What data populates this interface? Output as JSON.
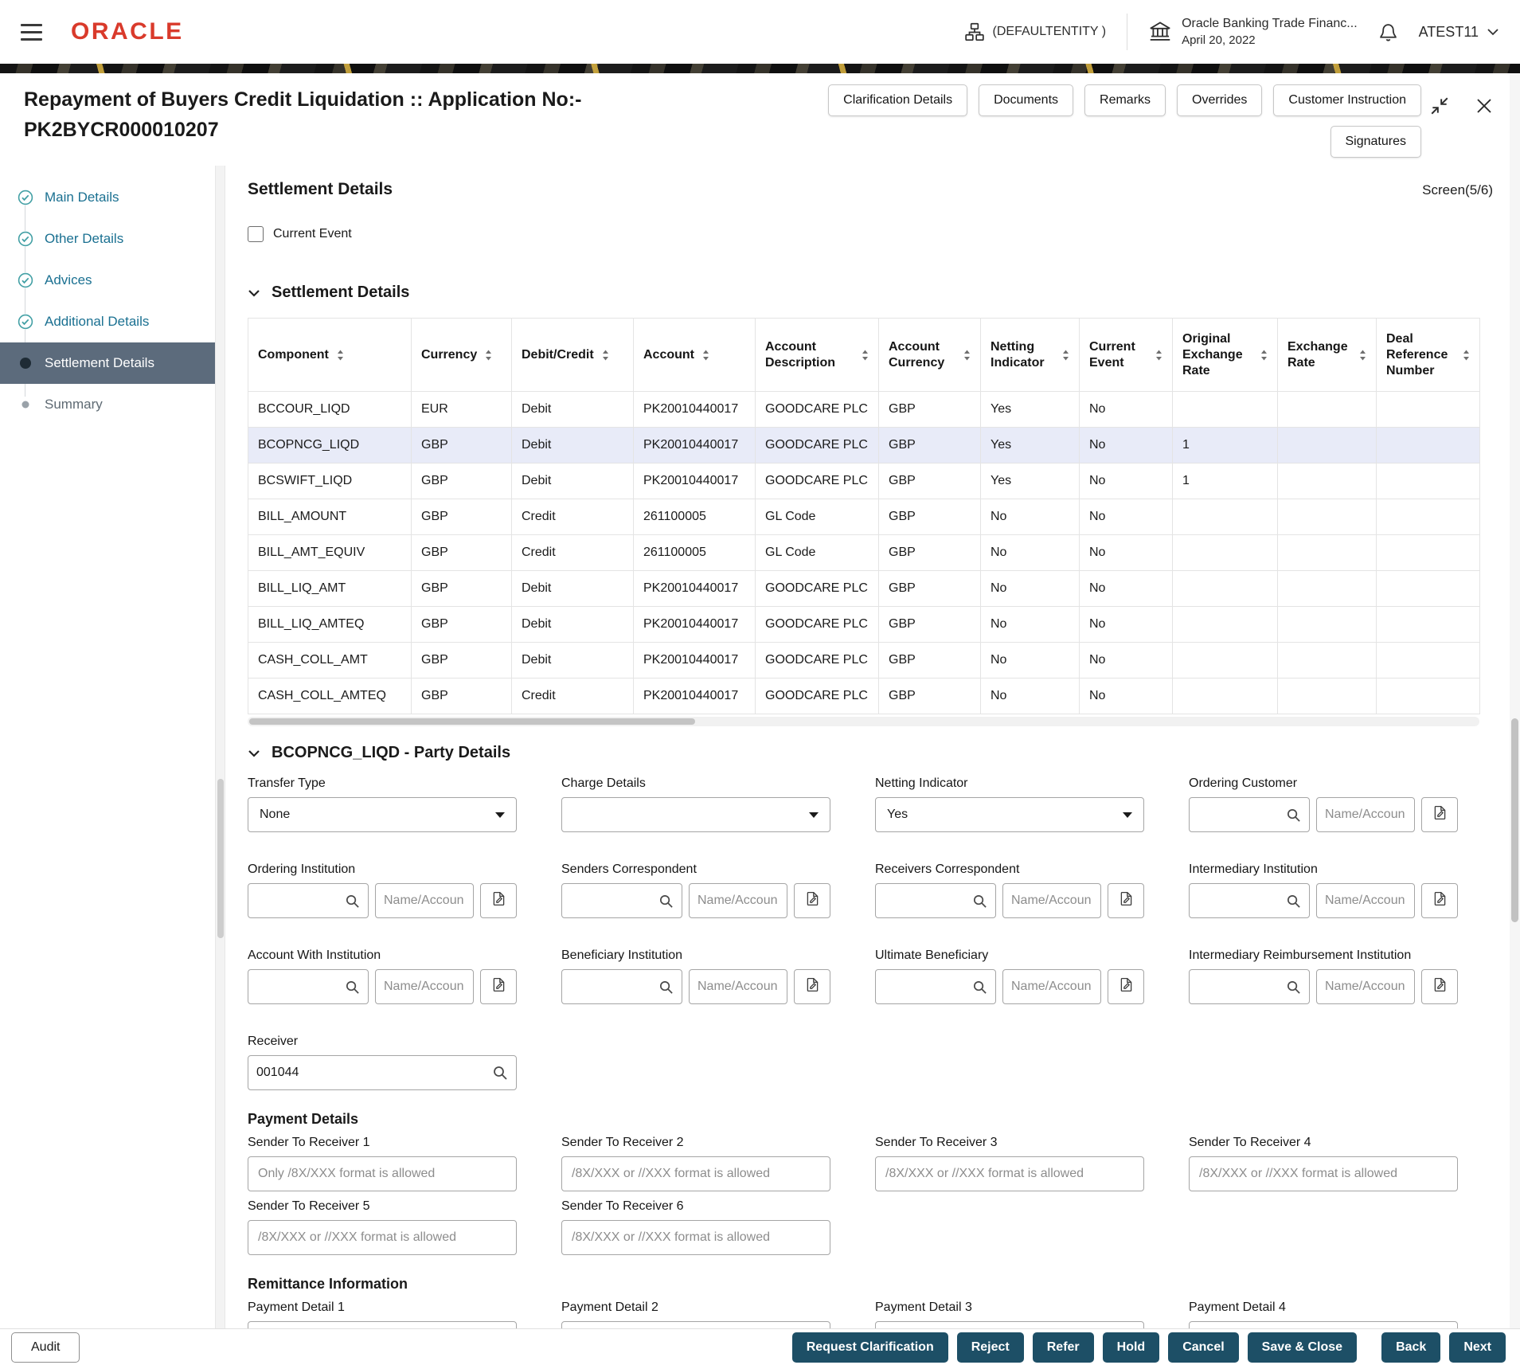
{
  "header": {
    "logo": "ORACLE",
    "entity_label": "(DEFAULTENTITY )",
    "app_name": "Oracle Banking Trade Financ...",
    "app_date": "April 20, 2022",
    "user_name": "ATEST11"
  },
  "titlebar": {
    "title_line1": "Repayment of Buyers Credit Liquidation :: Application No:-",
    "title_line2": "PK2BYCR000010207",
    "action_buttons": [
      "Clarification Details",
      "Documents",
      "Remarks",
      "Overrides",
      "Customer Instruction"
    ],
    "signatures_label": "Signatures"
  },
  "sidebar": {
    "items": [
      {
        "label": "Main Details",
        "state": "done"
      },
      {
        "label": "Other Details",
        "state": "done"
      },
      {
        "label": "Advices",
        "state": "done"
      },
      {
        "label": "Additional Details",
        "state": "done"
      },
      {
        "label": "Settlement Details",
        "state": "active"
      },
      {
        "label": "Summary",
        "state": "pending"
      }
    ]
  },
  "main": {
    "screen_title": "Settlement Details",
    "screen_indicator": "Screen(5/6)",
    "current_event_label": "Current Event",
    "settlement_section_title": "Settlement Details",
    "table": {
      "columns": [
        "Component",
        "Currency",
        "Debit/Credit",
        "Account",
        "Account Description",
        "Account Currency",
        "Netting Indicator",
        "Current Event",
        "Original Exchange Rate",
        "Exchange Rate",
        "Deal Reference Number"
      ],
      "selected_row_index": 1,
      "rows": [
        [
          "BCCOUR_LIQD",
          "EUR",
          "Debit",
          "PK20010440017",
          "GOODCARE PLC",
          "GBP",
          "Yes",
          "No",
          "",
          "",
          ""
        ],
        [
          "BCOPNCG_LIQD",
          "GBP",
          "Debit",
          "PK20010440017",
          "GOODCARE PLC",
          "GBP",
          "Yes",
          "No",
          "1",
          "",
          ""
        ],
        [
          "BCSWIFT_LIQD",
          "GBP",
          "Debit",
          "PK20010440017",
          "GOODCARE PLC",
          "GBP",
          "Yes",
          "No",
          "1",
          "",
          ""
        ],
        [
          "BILL_AMOUNT",
          "GBP",
          "Credit",
          "261100005",
          "GL Code",
          "GBP",
          "No",
          "No",
          "",
          "",
          ""
        ],
        [
          "BILL_AMT_EQUIV",
          "GBP",
          "Credit",
          "261100005",
          "GL Code",
          "GBP",
          "No",
          "No",
          "",
          "",
          ""
        ],
        [
          "BILL_LIQ_AMT",
          "GBP",
          "Debit",
          "PK20010440017",
          "GOODCARE PLC",
          "GBP",
          "No",
          "No",
          "",
          "",
          ""
        ],
        [
          "BILL_LIQ_AMTEQ",
          "GBP",
          "Debit",
          "PK20010440017",
          "GOODCARE PLC",
          "GBP",
          "No",
          "No",
          "",
          "",
          ""
        ],
        [
          "CASH_COLL_AMT",
          "GBP",
          "Debit",
          "PK20010440017",
          "GOODCARE PLC",
          "GBP",
          "No",
          "No",
          "",
          "",
          ""
        ],
        [
          "CASH_COLL_AMTEQ",
          "GBP",
          "Credit",
          "PK20010440017",
          "GOODCARE PLC",
          "GBP",
          "No",
          "No",
          "",
          "",
          ""
        ]
      ]
    },
    "party": {
      "section_title": "BCOPNCG_LIQD - Party Details",
      "transfer_type_label": "Transfer Type",
      "transfer_type_value": "None",
      "charge_details_label": "Charge Details",
      "charge_details_value": "",
      "netting_indicator_label": "Netting Indicator",
      "netting_indicator_value": "Yes",
      "name_placeholder": "Name/Accoun",
      "composite_fields": [
        "Ordering Customer",
        "Ordering Institution",
        "Senders Correspondent",
        "Receivers Correspondent",
        "Intermediary Institution",
        "Account With Institution",
        "Beneficiary Institution",
        "Ultimate Beneficiary",
        "Intermediary Reimbursement Institution"
      ],
      "receiver_label": "Receiver",
      "receiver_value": "001044"
    },
    "payment": {
      "title": "Payment Details",
      "fields": [
        {
          "label": "Sender To Receiver 1",
          "placeholder": "Only /8X/XXX format is allowed"
        },
        {
          "label": "Sender To Receiver 2",
          "placeholder": "/8X/XXX or //XXX format is allowed"
        },
        {
          "label": "Sender To Receiver 3",
          "placeholder": "/8X/XXX or //XXX format is allowed"
        },
        {
          "label": "Sender To Receiver 4",
          "placeholder": "/8X/XXX or //XXX format is allowed"
        },
        {
          "label": "Sender To Receiver 5",
          "placeholder": "/8X/XXX or //XXX format is allowed"
        },
        {
          "label": "Sender To Receiver 6",
          "placeholder": "/8X/XXX or //XXX format is allowed"
        }
      ]
    },
    "remittance": {
      "title": "Remittance Information",
      "fields": [
        "Payment Detail 1",
        "Payment Detail 2",
        "Payment Detail 3",
        "Payment Detail 4"
      ]
    }
  },
  "footer": {
    "audit_label": "Audit",
    "action_buttons": [
      "Request Clarification",
      "Reject",
      "Refer",
      "Hold",
      "Cancel",
      "Save & Close",
      "Back",
      "Next"
    ]
  },
  "colors": {
    "oracle_red": "#d93a2b",
    "accent_teal": "#43a0a5",
    "active_step_bg": "#5c6b7c",
    "sidebar_link_blue": "#1a7091",
    "primary_button_bg": "#1d4f66",
    "selected_row_bg": "#e8ebf8"
  }
}
